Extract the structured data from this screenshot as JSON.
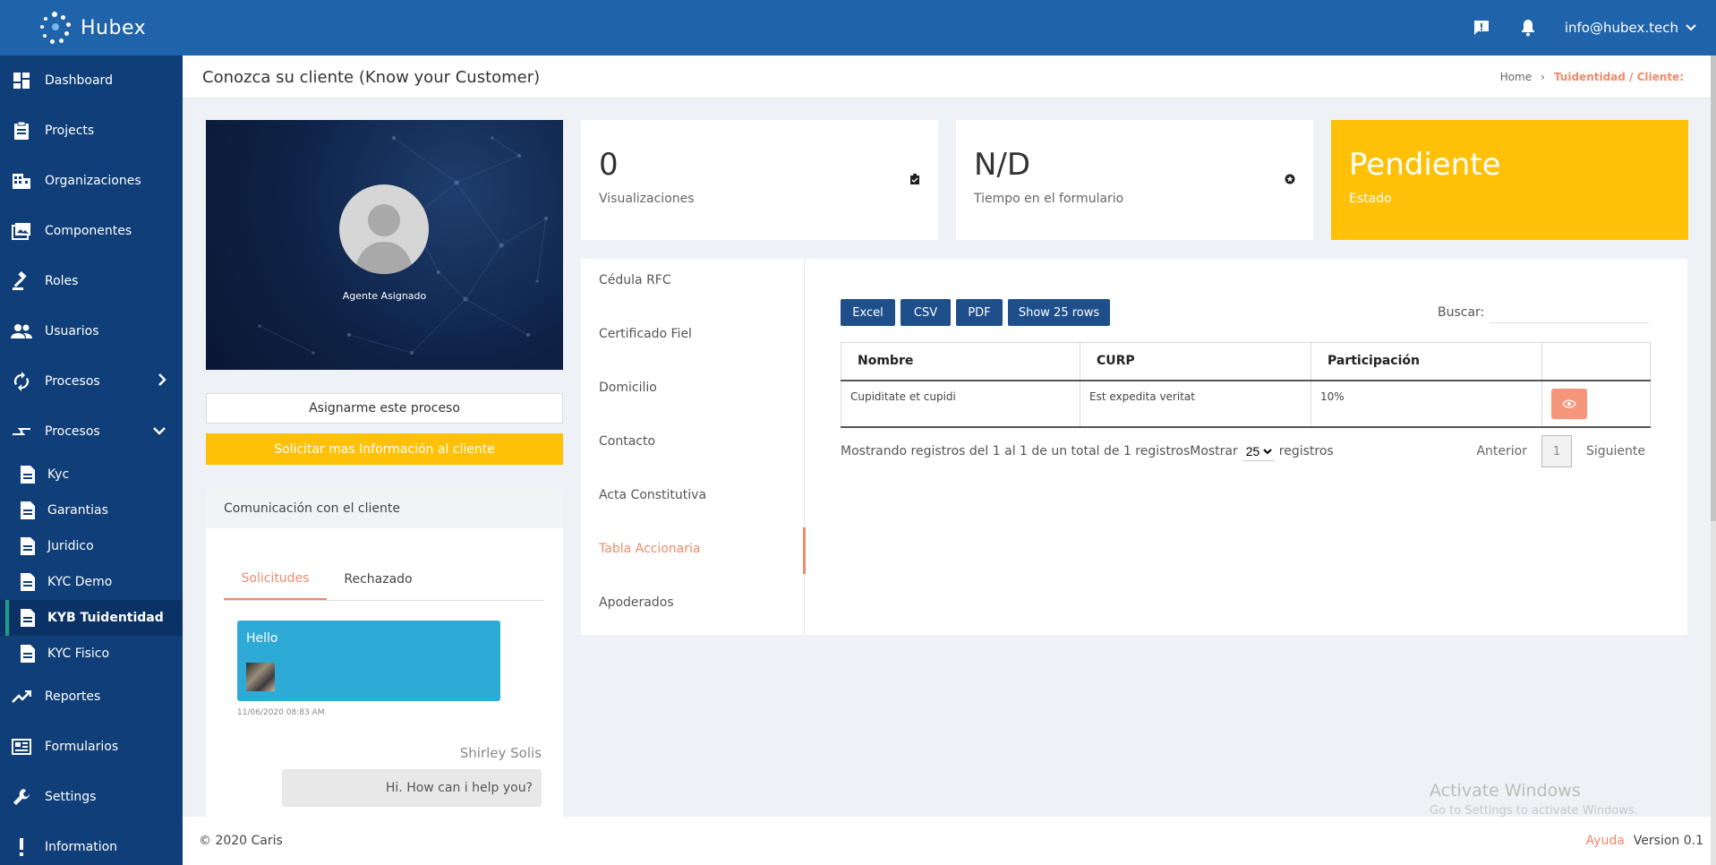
{
  "app": {
    "name": "Hubex",
    "user_email": "info@hubex.tech"
  },
  "sidebar": {
    "items": [
      {
        "label": "Dashboard",
        "icon": "dashboard-icon"
      },
      {
        "label": "Projects",
        "icon": "clipboard-icon"
      },
      {
        "label": "Organizaciones",
        "icon": "building-icon"
      },
      {
        "label": "Componentes",
        "icon": "image-icon"
      },
      {
        "label": "Roles",
        "icon": "gavel-icon"
      },
      {
        "label": "Usuarios",
        "icon": "users-icon"
      },
      {
        "label": "Procesos",
        "icon": "sync-icon"
      },
      {
        "label": "Procesos",
        "icon": "swap-icon"
      }
    ],
    "subitems": [
      {
        "label": "Kyc"
      },
      {
        "label": "Garantias"
      },
      {
        "label": "Juridico"
      },
      {
        "label": "KYC Demo"
      },
      {
        "label": "KYB Tuidentidad"
      },
      {
        "label": "KYC Fisico"
      }
    ],
    "bottom_items": [
      {
        "label": "Reportes",
        "icon": "trending-icon"
      },
      {
        "label": "Formularios",
        "icon": "form-icon"
      },
      {
        "label": "Settings",
        "icon": "wrench-icon"
      },
      {
        "label": "Information",
        "icon": "exclamation-icon"
      }
    ]
  },
  "header": {
    "title": "Conozca su cliente (Know your Customer)",
    "breadcrumb_home": "Home",
    "breadcrumb_current": "Tuidentidad / Cliente:"
  },
  "profile": {
    "label": "Agente Asignado",
    "assign_button": "Asignarme este proceso",
    "request_button": "Solicitar mas Información al cliente"
  },
  "communication": {
    "title": "Comunicación con el cliente",
    "tabs": [
      "Solicitudes",
      "Rechazado"
    ],
    "message1": "Hello",
    "message1_time": "11/06/2020 08:83 AM",
    "author": "Shirley Solis",
    "message2": "Hi. How can i help you?"
  },
  "stats": {
    "views_value": "0",
    "views_label": "Visualizaciones",
    "time_value": "N/D",
    "time_label": "Tiempo en el formulario",
    "status_value": "Pendiente",
    "status_label": "Estado"
  },
  "documents": [
    "Cédula RFC",
    "Certificado Fiel",
    "Domicilio",
    "Contacto",
    "Acta Constitutiva",
    "Tabla Accionaria",
    "Apoderados"
  ],
  "table": {
    "buttons": [
      "Excel",
      "CSV",
      "PDF",
      "Show 25 rows"
    ],
    "search_label": "Buscar:",
    "columns": [
      "Nombre",
      "CURP",
      "Participación",
      ""
    ],
    "rows": [
      [
        "Cupiditate et cupidi",
        "Est expedita veritat",
        "10%"
      ]
    ],
    "showing_text": "Mostrando registros del 1 al 1 de un total de 1 registrosMostrar",
    "page_size": "25",
    "records_label": "registros",
    "prev": "Anterior",
    "page": "1",
    "next": "Siguiente"
  },
  "watermark": {
    "line1": "Activate Windows",
    "line2": "Go to Settings to activate Windows."
  },
  "footer": {
    "copyright": "© 2020 Caris",
    "help": "Ayuda",
    "version": "Version 0.1"
  },
  "colors": {
    "topbar": "#1f63ab",
    "sidebar": "#0f3e78",
    "accent": "#f08a6c",
    "status": "#ffc107",
    "button": "#1f4f8a"
  }
}
